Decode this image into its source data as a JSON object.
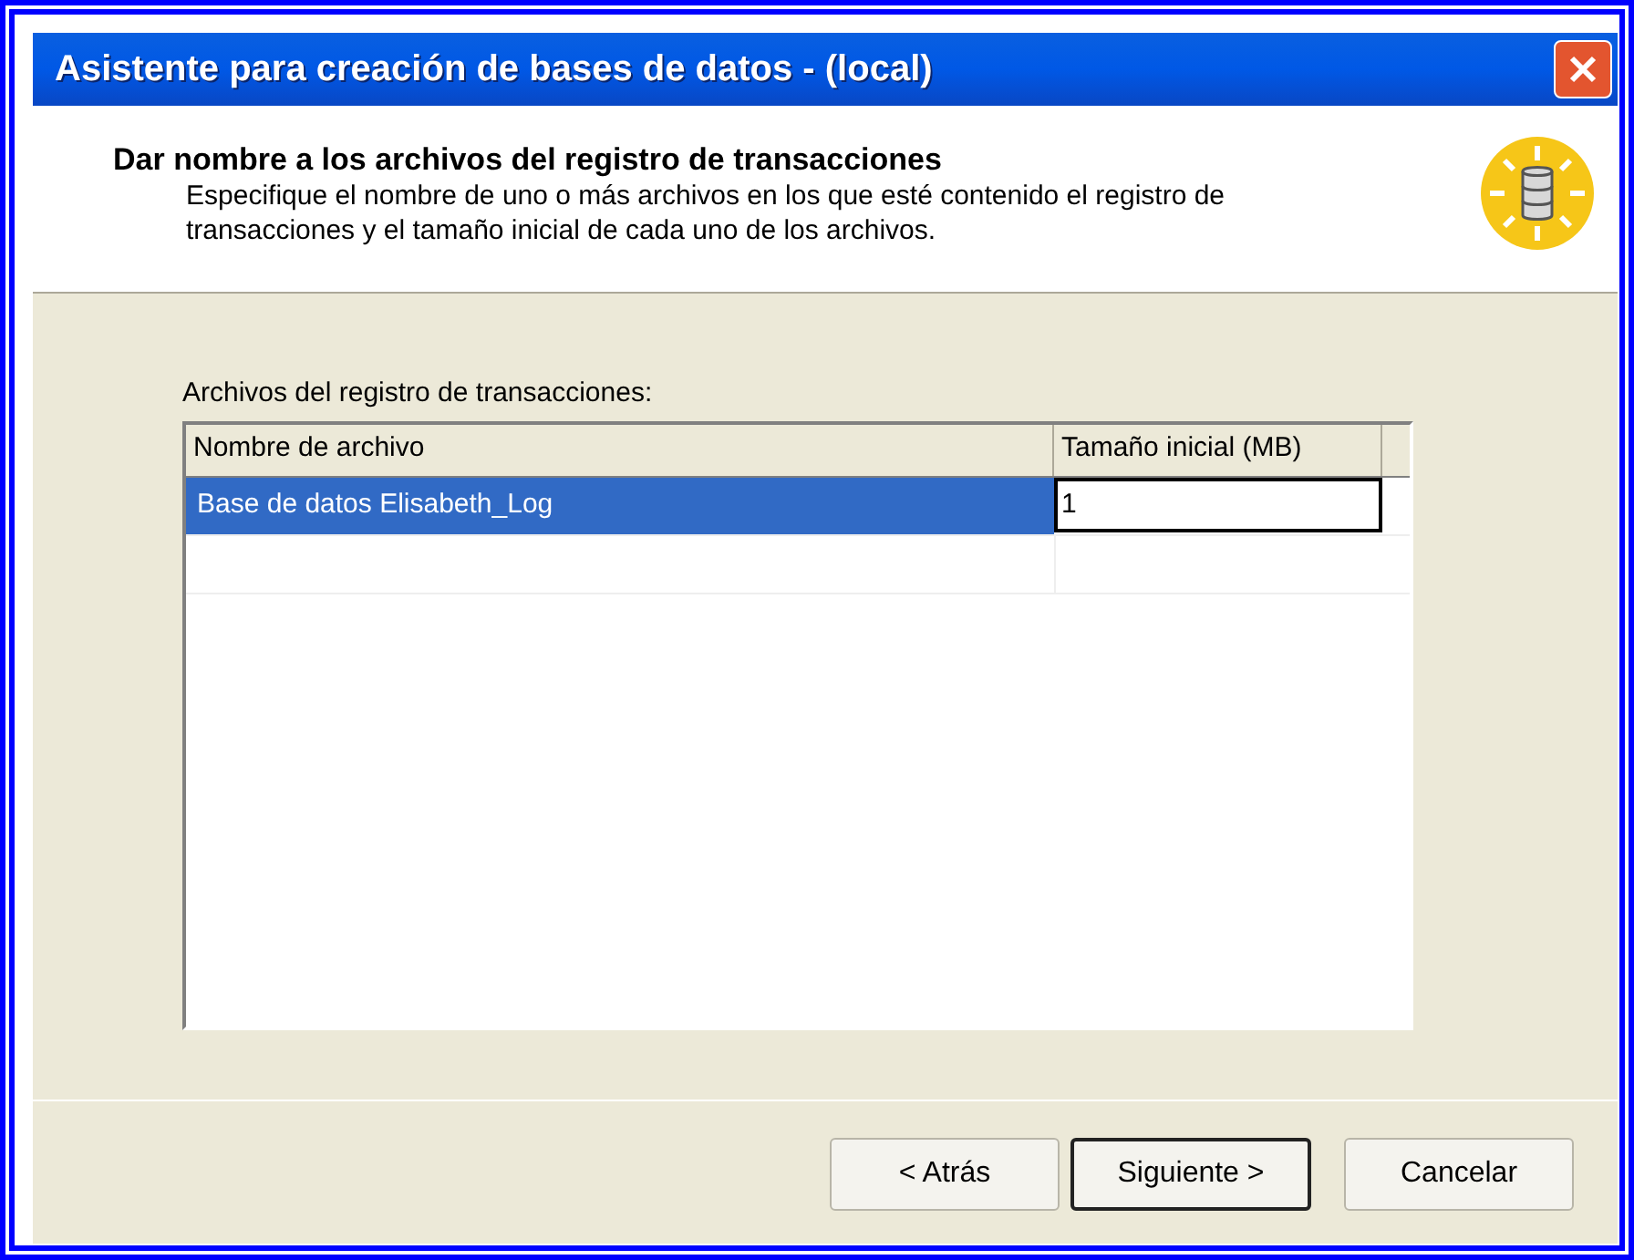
{
  "window": {
    "title": "Asistente para creación de bases de datos - (local)"
  },
  "header": {
    "title": "Dar nombre a los archivos del registro de transacciones",
    "description": "Especifique el nombre de uno o más archivos en los que esté contenido el registro de transacciones y el tamaño inicial de cada uno de los archivos."
  },
  "list_label": "Archivos del registro de transacciones:",
  "table": {
    "columns": [
      "Nombre de archivo",
      "Tamaño inicial (MB)"
    ],
    "rows": [
      {
        "file_name": "Base de datos Elisabeth_Log",
        "initial_size": "1",
        "selected": true
      }
    ]
  },
  "buttons": [
    {
      "label": "< Atrás",
      "default": false
    },
    {
      "label": "Siguiente >",
      "default": true
    },
    {
      "label": "Cancelar",
      "default": false
    }
  ]
}
